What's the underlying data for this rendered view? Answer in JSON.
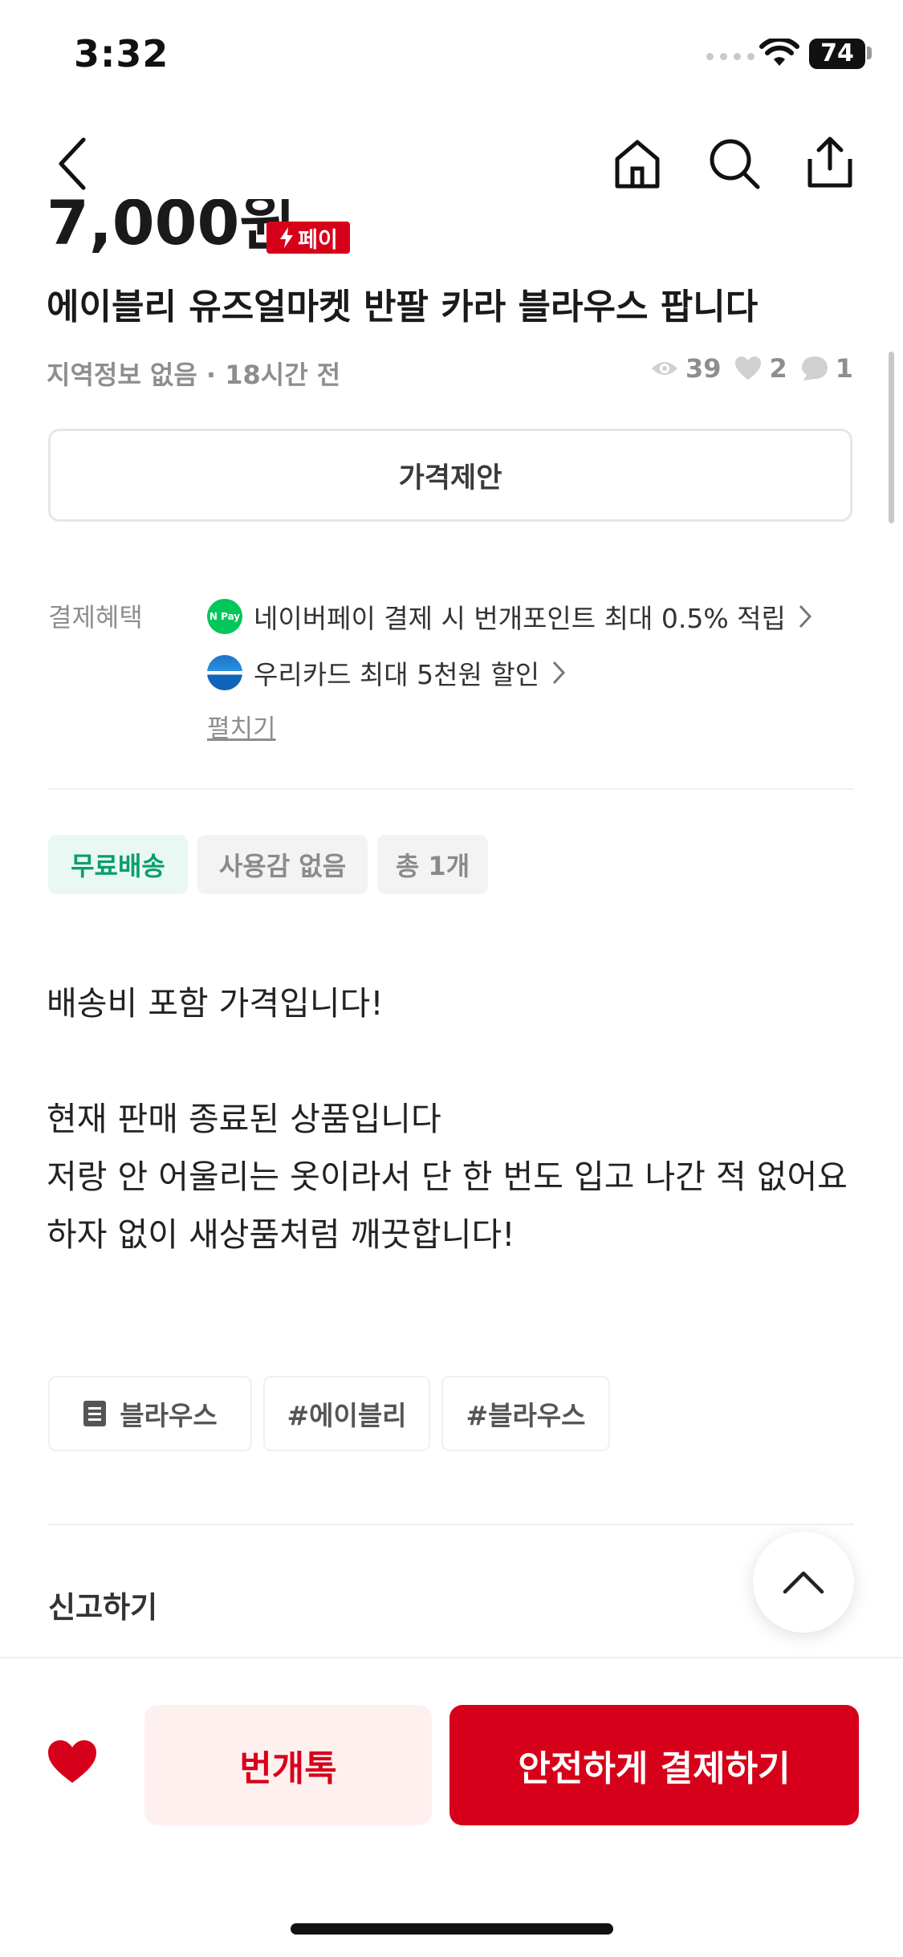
{
  "status_bar": {
    "time": "3:32",
    "battery": "74"
  },
  "product": {
    "price": "7,000원",
    "pay_badge": "페이",
    "title": "에이블리 유즈얼마켓 반팔 카라 블라우스 팝니다",
    "meta": "지역정보 없음 · 18시간 전",
    "views": "39",
    "likes": "2",
    "chats": "1"
  },
  "offer_button": "가격제안",
  "benefits": {
    "label": "결제혜택",
    "naver_logo": "N Pay",
    "naver": "네이버페이 결제 시 번개포인트 최대 0.5% 적립",
    "woori": "우리카드 최대 5천원 할인",
    "expand": "펼치기"
  },
  "tags": [
    "무료배송",
    "사용감 없음",
    "총 1개"
  ],
  "description": "배송비 포함 가격입니다!\n\n현재 판매 종료된 상품입니다\n저랑 안 어울리는 옷이라서 단 한 번도 입고 나간 적 없어요 하자 없이 새상품처럼 깨끗합니다!",
  "chips": [
    "블라우스",
    "#에이블리",
    "#블라우스"
  ],
  "report": "신고하기",
  "bottom": {
    "chat": "번개톡",
    "pay": "안전하게 결제하기"
  },
  "colors": {
    "accent": "#d7001a",
    "green": "#0a9d6e",
    "naver": "#03c75a"
  },
  "icons": [
    "back-arrow-icon",
    "home-icon",
    "search-icon",
    "share-icon",
    "lightning-icon",
    "eye-icon",
    "heart-icon",
    "chat-bubble-icon",
    "chevron-right-icon",
    "document-icon",
    "chevron-up-icon"
  ]
}
